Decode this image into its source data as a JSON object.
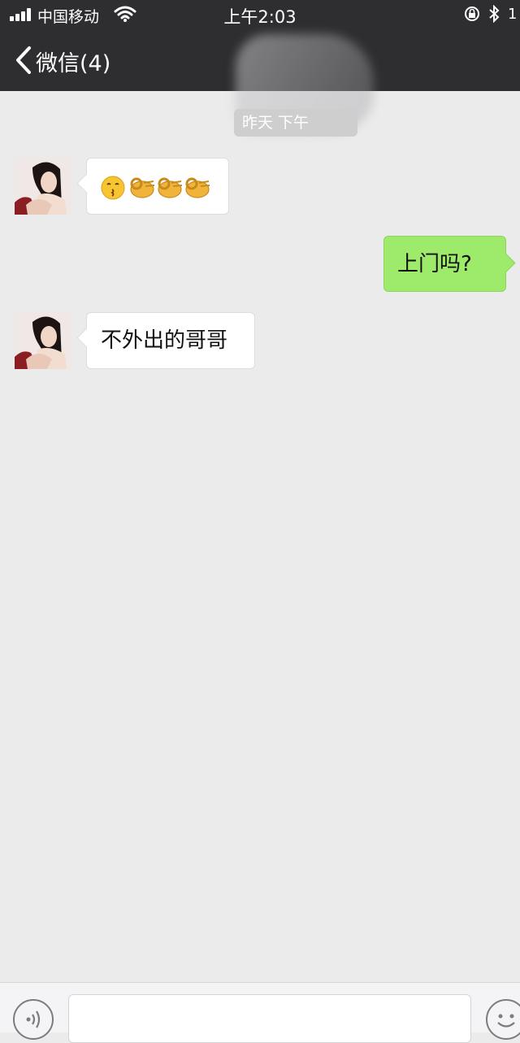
{
  "status_bar": {
    "carrier": "中国移动",
    "time": "上午2:03",
    "battery_partial": "1"
  },
  "nav": {
    "back_label": "微信(4)"
  },
  "chat": {
    "timestamp": "昨天 下午",
    "messages": [
      {
        "direction": "incoming",
        "content": "😚👌👌👌",
        "kind": "emoji"
      },
      {
        "direction": "outgoing",
        "content": "上门吗?"
      },
      {
        "direction": "incoming",
        "content": "不外出的哥哥"
      }
    ]
  },
  "colors": {
    "header_bg": "#2e2e30",
    "chat_bg": "#ebebeb",
    "outgoing_bubble": "#9eea6a",
    "incoming_bubble": "#ffffff"
  },
  "icons": {
    "back": "chevron-left-icon",
    "voice": "voice-input-icon",
    "emoji": "emoji-face-icon"
  }
}
